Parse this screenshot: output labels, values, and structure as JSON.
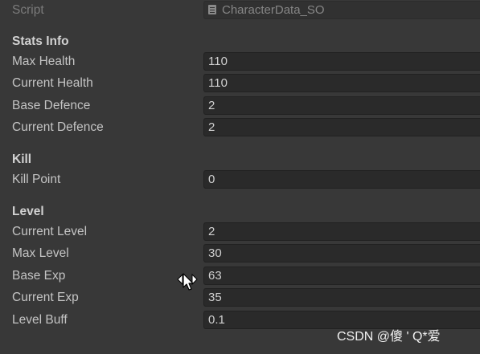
{
  "script": {
    "label": "Script",
    "value": "CharacterData_SO",
    "icon": "script-file-icon"
  },
  "sections": {
    "stats": {
      "header": "Stats Info",
      "fields": [
        {
          "label": "Max Health",
          "value": "110"
        },
        {
          "label": "Current Health",
          "value": "110"
        },
        {
          "label": "Base Defence",
          "value": "2"
        },
        {
          "label": "Current Defence",
          "value": "2"
        }
      ]
    },
    "kill": {
      "header": "Kill",
      "fields": [
        {
          "label": "Kill Point",
          "value": "0"
        }
      ]
    },
    "level": {
      "header": "Level",
      "fields": [
        {
          "label": "Current Level",
          "value": "2"
        },
        {
          "label": "Max Level",
          "value": "30"
        },
        {
          "label": "Base Exp",
          "value": "63"
        },
        {
          "label": "Current Exp",
          "value": "35"
        },
        {
          "label": "Level Buff",
          "value": "0.1"
        }
      ]
    }
  },
  "cursor": {
    "icon": "resize-cursor-icon"
  },
  "watermark": "CSDN @傻 ' Q*爱"
}
